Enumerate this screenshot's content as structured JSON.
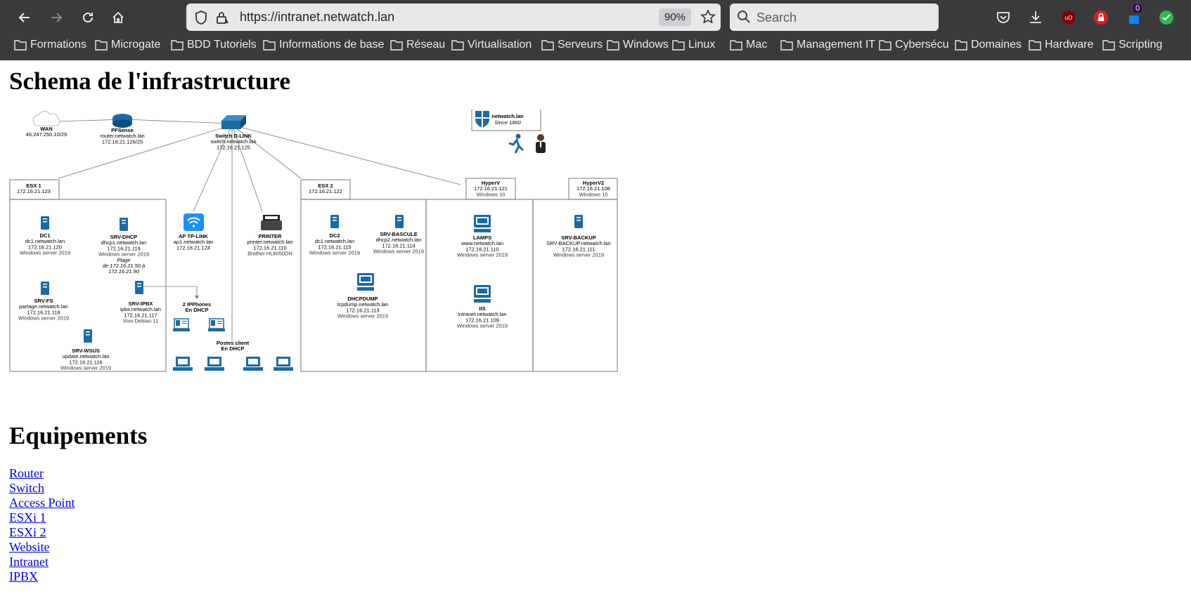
{
  "browser": {
    "url": "https://intranet.netwatch.lan",
    "url_host_display": "https://intranet.netwatch.lan",
    "zoom": "90%",
    "search_placeholder": "Search",
    "ublock_badge": "",
    "extension_badge": "0",
    "bookmarks": [
      "Formations",
      "Microgate",
      "BDD Tutoriels",
      "Informations de base",
      "Réseau",
      "Virtualisation",
      "Serveurs",
      "Windows",
      "Linux",
      "Mac",
      "Management IT",
      "Cybersécu",
      "Domaines",
      "Hardware",
      "Scripting"
    ]
  },
  "page": {
    "title1": "Schema de l'infrastructure",
    "title2": "Equipements",
    "links": [
      "Router",
      "Switch",
      "Access Point",
      "ESXi 1",
      "ESXi 2",
      "Website",
      "Intranet",
      "IPBX"
    ]
  },
  "diagram": {
    "wan": {
      "name": "WAN",
      "ip": "46.247.250.10/29"
    },
    "pfsense": {
      "name": "PFSense",
      "host": "router.netwatch.lan",
      "ip": "172.16.21.126/25"
    },
    "switch": {
      "name": "Switch D-LINK",
      "host": "switch.netwatch.lan",
      "ip": "172.16.21.125"
    },
    "logo": {
      "name": "netwatch.lan",
      "since": "Since 1860"
    },
    "esx1": {
      "name": "ESX 1",
      "ip": "172.16.21.123"
    },
    "esx2": {
      "name": "ESX 2",
      "ip": "172.16.21.122"
    },
    "hyperv": {
      "name": "HyperV",
      "ip": "172.16.21.121",
      "os": "Windows 10"
    },
    "hyperv2": {
      "name": "HyperV2",
      "ip": "172.16.21.108",
      "os": "Windows 10"
    },
    "dc1": {
      "name": "DC1",
      "host": "dc1.netwatch.lan",
      "ip": "172.16.21.120",
      "os": "Windows server 2019"
    },
    "srvdhcp": {
      "name": "SRV-DHCP",
      "host": "dhcp1.netwatch.lan",
      "ip": "172.16.21.119",
      "os": "Windows server 2019",
      "range1": "Plage",
      "range2": "de 172.16.21.50 à",
      "range3": "172.16.21.90"
    },
    "srvfs": {
      "name": "SRV-FS",
      "host": "partage.netwatch.lan",
      "ip": "172.16.21.118",
      "os": "Windows server 2019"
    },
    "srvipbx": {
      "name": "SRV-IPBX",
      "host": "ipbx.netwatch.lan",
      "ip": "172.16.21.117",
      "os": "Xivo Debian 11"
    },
    "srvwsus": {
      "name": "SRV-WSUS",
      "host": "update.netwatch.lan",
      "ip": "172.16.21.116",
      "os": "Windows server 2019"
    },
    "ap": {
      "name": "AP TP-LINK",
      "host": "ap1.netwatch.lan",
      "ip": "172.16.21.124"
    },
    "printer": {
      "name": "PRINTER",
      "host": "printer.netwatch.lan",
      "ip": "172.16.21.110",
      "model": "Brother HL6050DN"
    },
    "ipphones": {
      "l1": "2 IPPhones",
      "l2": "En DHCP"
    },
    "clients": {
      "l1": "Postes client",
      "l2": "En DHCP"
    },
    "dc2": {
      "name": "DC2",
      "host": "dc1.netwatch.lan",
      "ip": "172.16.21.115",
      "os": "Windows server 2019"
    },
    "bascule": {
      "name": "SRV-BASCULE",
      "host": "dhcp2.netwatch.lan",
      "ip": "172.16.21.114",
      "os": "Windows server 2019"
    },
    "dhcpdump": {
      "name": "DHCPDUMP",
      "host": "tcpdump.netwatch.lan",
      "ip": "172.16.21.113",
      "os": "Windows server 2019"
    },
    "lamps": {
      "name": "LAMPS",
      "host": "www.netwatch.lan",
      "ip": "172.16.21.110",
      "os": "Windows server 2019"
    },
    "iis": {
      "name": "IIS",
      "host": "intranet.netwatch.lan",
      "ip": "172.16.21.109",
      "os": "Windows server 2019"
    },
    "backup": {
      "name": "SRV-BACKUP",
      "host": "SRV-BACKUP.netwatch.lan",
      "ip": "172.16.21.111",
      "os": "Windows server 2019"
    }
  },
  "colors": {
    "chrome": "#3a3a3d",
    "link": "#0000ee",
    "accent": "#1a6aa6"
  }
}
